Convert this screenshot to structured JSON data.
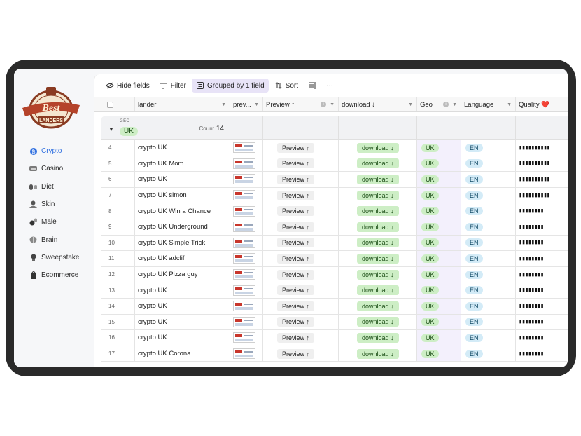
{
  "sidebar": {
    "logo_text": "BestLanders",
    "items": [
      {
        "label": "Crypto",
        "icon": "bitcoin-icon",
        "active": true
      },
      {
        "label": "Casino",
        "icon": "casino-chip-icon",
        "active": false
      },
      {
        "label": "Diet",
        "icon": "pills-icon",
        "active": false
      },
      {
        "label": "Skin",
        "icon": "skin-icon",
        "active": false
      },
      {
        "label": "Male",
        "icon": "male-icon",
        "active": false
      },
      {
        "label": "Brain",
        "icon": "brain-icon",
        "active": false
      },
      {
        "label": "Sweepstake",
        "icon": "trophy-icon",
        "active": false
      },
      {
        "label": "Ecommerce",
        "icon": "shopping-bag-icon",
        "active": false
      }
    ]
  },
  "toolbar": {
    "hide_fields": "Hide fields",
    "filter": "Filter",
    "grouped": "Grouped by 1 field",
    "sort": "Sort",
    "more": "···"
  },
  "columns": {
    "lander": "lander",
    "prev": "prev...",
    "preview": "Preview ↑",
    "download": "download ↓",
    "geo": "Geo",
    "language": "Language",
    "quality": "Quality ❤️"
  },
  "group": {
    "field": "GEO",
    "value": "UK",
    "count_label": "Count",
    "count": "14"
  },
  "rows": [
    {
      "n": "4",
      "lander": "crypto UK",
      "preview": "Preview ↑",
      "download": "download ↓",
      "geo": "UK",
      "lang": "EN",
      "quality": "▮▮▮▮▮▮▮▮▮▮"
    },
    {
      "n": "5",
      "lander": "crypto UK Mom",
      "preview": "Preview ↑",
      "download": "download ↓",
      "geo": "UK",
      "lang": "EN",
      "quality": "▮▮▮▮▮▮▮▮▮▮"
    },
    {
      "n": "6",
      "lander": "crypto UK",
      "preview": "Preview ↑",
      "download": "download ↓",
      "geo": "UK",
      "lang": "EN",
      "quality": "▮▮▮▮▮▮▮▮▮▮"
    },
    {
      "n": "7",
      "lander": "crypto UK simon",
      "preview": "Preview ↑",
      "download": "download ↓",
      "geo": "UK",
      "lang": "EN",
      "quality": "▮▮▮▮▮▮▮▮▮▮"
    },
    {
      "n": "8",
      "lander": "crypto UK Win a Chance",
      "preview": "Preview ↑",
      "download": "download ↓",
      "geo": "UK",
      "lang": "EN",
      "quality": "▮▮▮▮▮▮▮▮"
    },
    {
      "n": "9",
      "lander": "crypto UK Underground",
      "preview": "Preview ↑",
      "download": "download ↓",
      "geo": "UK",
      "lang": "EN",
      "quality": "▮▮▮▮▮▮▮▮"
    },
    {
      "n": "10",
      "lander": "crypto UK Simple Trick",
      "preview": "Preview ↑",
      "download": "download ↓",
      "geo": "UK",
      "lang": "EN",
      "quality": "▮▮▮▮▮▮▮▮"
    },
    {
      "n": "11",
      "lander": "crypto UK adclif",
      "preview": "Preview ↑",
      "download": "download ↓",
      "geo": "UK",
      "lang": "EN",
      "quality": "▮▮▮▮▮▮▮▮"
    },
    {
      "n": "12",
      "lander": "crypto UK Pizza guy",
      "preview": "Preview ↑",
      "download": "download ↓",
      "geo": "UK",
      "lang": "EN",
      "quality": "▮▮▮▮▮▮▮▮"
    },
    {
      "n": "13",
      "lander": "crypto UK",
      "preview": "Preview ↑",
      "download": "download ↓",
      "geo": "UK",
      "lang": "EN",
      "quality": "▮▮▮▮▮▮▮▮"
    },
    {
      "n": "14",
      "lander": "crypto UK",
      "preview": "Preview ↑",
      "download": "download ↓",
      "geo": "UK",
      "lang": "EN",
      "quality": "▮▮▮▮▮▮▮▮"
    },
    {
      "n": "15",
      "lander": "crypto UK",
      "preview": "Preview ↑",
      "download": "download ↓",
      "geo": "UK",
      "lang": "EN",
      "quality": "▮▮▮▮▮▮▮▮"
    },
    {
      "n": "16",
      "lander": "crypto UK",
      "preview": "Preview ↑",
      "download": "download ↓",
      "geo": "UK",
      "lang": "EN",
      "quality": "▮▮▮▮▮▮▮▮"
    },
    {
      "n": "17",
      "lander": "crypto UK Corona",
      "preview": "Preview ↑",
      "download": "download ↓",
      "geo": "UK",
      "lang": "EN",
      "quality": "▮▮▮▮▮▮▮▮"
    }
  ],
  "colors": {
    "accent_blue": "#2f6fe0",
    "green_pill": "#cdeec5",
    "blue_pill": "#d3ebf7",
    "toolbar_active": "#e8e3f7"
  }
}
